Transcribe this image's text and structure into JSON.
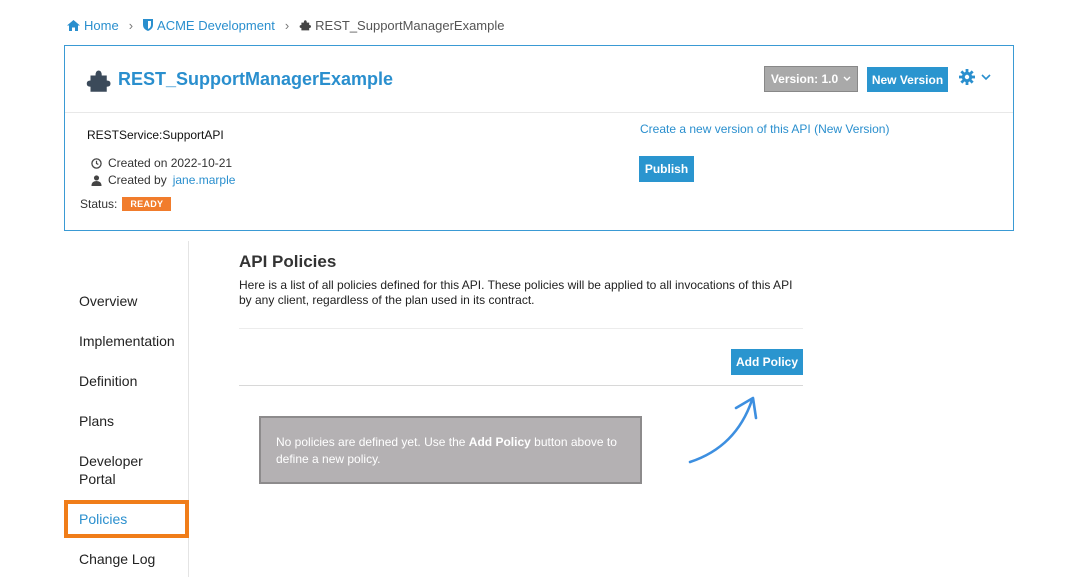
{
  "breadcrumb": {
    "home": "Home",
    "org": "ACME Development",
    "api": "REST_SupportManagerExample"
  },
  "header": {
    "title": "REST_SupportManagerExample",
    "version_label": "Version: 1.0",
    "new_version_button": "New Version",
    "service_name": "RESTService:SupportAPI",
    "created_on": "Created on 2022-10-21",
    "created_by_prefix": "Created by",
    "created_by_user": "jane.marple",
    "status_label": "Status:",
    "status_value": "READY",
    "new_version_link": "Create a new version of this API (New Version)",
    "publish_button": "Publish"
  },
  "sidebar": {
    "items": [
      {
        "label": "Overview"
      },
      {
        "label": "Implementation"
      },
      {
        "label": "Definition"
      },
      {
        "label": "Plans"
      },
      {
        "label": "Developer Portal"
      },
      {
        "label": "Policies"
      },
      {
        "label": "Change Log"
      }
    ]
  },
  "main": {
    "title": "API Policies",
    "description": "Here is a list of all policies defined for this API. These policies will be applied to all invocations of this API by any client, regardless of the plan used in its contract.",
    "add_policy_button": "Add Policy",
    "empty_prefix": "No policies are defined yet. Use the",
    "empty_bold": "Add Policy",
    "empty_suffix": "button above to define a new policy."
  },
  "colors": {
    "accent": "#2a95cf",
    "status_badge": "#f17c2c",
    "highlight_box": "#f07d19",
    "annotation_arrow": "#3d8fe0"
  }
}
